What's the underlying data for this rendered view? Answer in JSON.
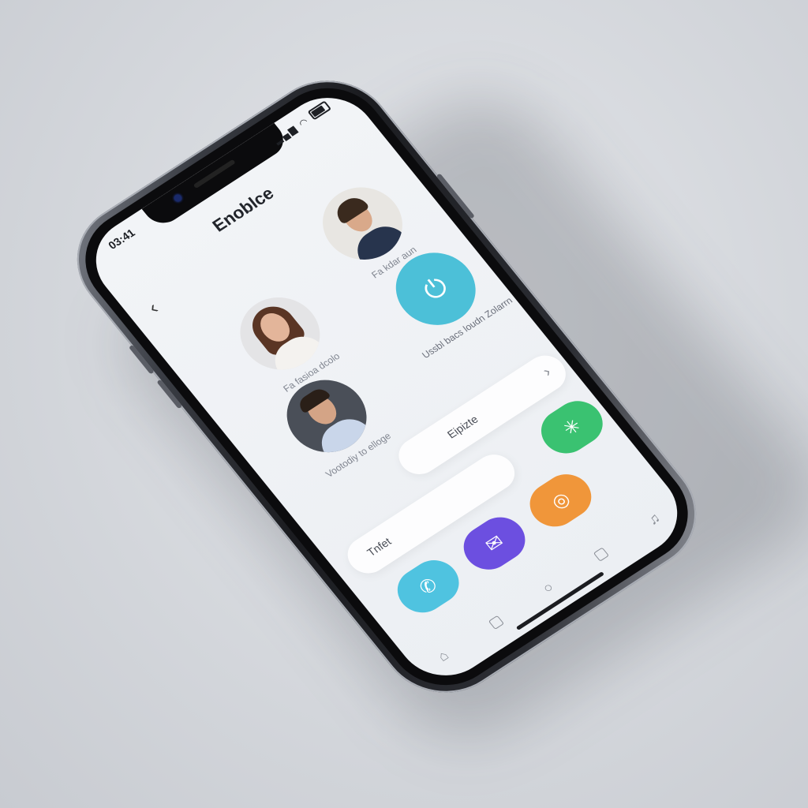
{
  "status_bar": {
    "time": "03:41"
  },
  "header": {
    "title": "Enoblce",
    "back_icon": "chevron-left-icon"
  },
  "contacts": [
    {
      "name": "Fa kdar aun",
      "avatar": "avatar-man-1"
    },
    {
      "name": "Fa fasioa dcolo",
      "avatar": "avatar-woman"
    },
    {
      "name": "Vootodiy to elloge",
      "avatar": "avatar-man-2"
    }
  ],
  "feature": {
    "label": "Ussbl bacs loudn Zolarrn",
    "icon": "timer-icon"
  },
  "pills": {
    "top_label": "Eipizte",
    "search_label": "Tnfet"
  },
  "apps": [
    {
      "name": "phone",
      "color": "#4fc3e0",
      "icon": "phone-icon"
    },
    {
      "name": "purple-app",
      "color": "#6c4fe0",
      "icon": "chat-icon"
    },
    {
      "name": "orange-app",
      "color": "#f0963a",
      "icon": "camera-icon"
    },
    {
      "name": "green-app",
      "color": "#3ac271",
      "icon": "sparkle-icon"
    }
  ],
  "colors": {
    "accent_cyan": "#4cc0d8",
    "screen_bg": "#eef1f4"
  }
}
